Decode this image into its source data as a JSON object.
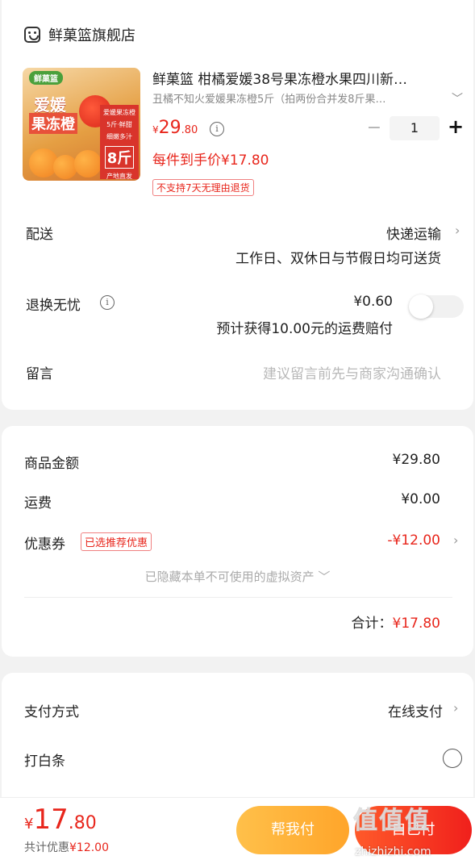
{
  "store": {
    "name": "鲜菓篮旗舰店",
    "icon": "store-icon"
  },
  "product": {
    "thumb_brand": "鲜菓篮",
    "thumb_text1": "爱媛",
    "thumb_text2": "果冻橙",
    "thumb_box_line1": "爱媛果冻橙",
    "thumb_box_line2": "5斤·鲜甜",
    "thumb_box_line3": "细嫩多汁",
    "thumb_box_weight": "8斤",
    "thumb_box_origin": "产地直发",
    "title": "鲜菓篮 柑橘爱媛38号果冻橙水果四川新…",
    "spec": "丑橘不知火爱媛果冻橙5斤（拍两份合并发8斤果…",
    "price_currency": "¥",
    "price_int": "29",
    "price_dec": ".80",
    "quantity": "1",
    "minus": "−",
    "plus": "+",
    "unit_price": "每件到手价¥17.80",
    "no_return": "不支持7天无理由退货"
  },
  "delivery": {
    "label": "配送",
    "method": "快递运输",
    "note": "工作日、双休日与节假日均可送货"
  },
  "return_insurance": {
    "label": "退换无忧",
    "price": "¥0.60",
    "note": "预计获得10.00元的运费赔付",
    "enabled": false
  },
  "message": {
    "label": "留言",
    "placeholder": "建议留言前先与商家沟通确认"
  },
  "summary": {
    "goods_label": "商品金额",
    "goods_value": "¥29.80",
    "shipping_label": "运费",
    "shipping_value": "¥0.00",
    "coupon_label": "优惠券",
    "coupon_tag": "已选推荐优惠",
    "coupon_value": "-¥12.00",
    "hidden_note": "已隐藏本单不可使用的虚拟资产 ﹀",
    "total_label": "合计：",
    "total_value": "¥17.80"
  },
  "payment": {
    "method_label": "支付方式",
    "method_value": "在线支付",
    "baitiao_label": "打白条",
    "baitiao_selected": false
  },
  "bottom": {
    "currency": "¥",
    "int": "17",
    "dec": ".80",
    "discount_label": "共计优惠",
    "discount_value": "¥12.00",
    "help_pay": "帮我付",
    "pay": "自己付"
  },
  "watermark": {
    "top": "值值值",
    "bottom": "zhizhizhi.com"
  },
  "colors": {
    "accent_red": "#e8261c",
    "help_orange": "#ffb038",
    "background": "#f2f2f2"
  }
}
